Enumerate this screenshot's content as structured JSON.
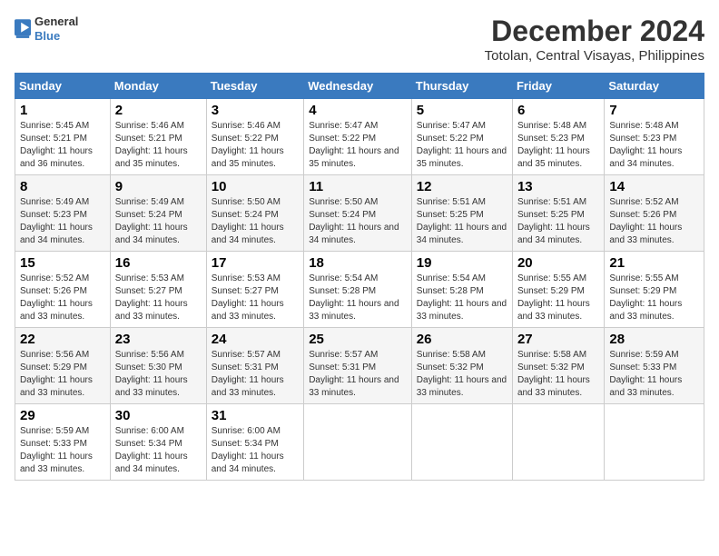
{
  "logo": {
    "line1": "General",
    "line2": "Blue"
  },
  "title": "December 2024",
  "subtitle": "Totolan, Central Visayas, Philippines",
  "headers": [
    "Sunday",
    "Monday",
    "Tuesday",
    "Wednesday",
    "Thursday",
    "Friday",
    "Saturday"
  ],
  "weeks": [
    [
      {
        "day": "1",
        "sunrise": "5:45 AM",
        "sunset": "5:21 PM",
        "daylight": "11 hours and 36 minutes."
      },
      {
        "day": "2",
        "sunrise": "5:46 AM",
        "sunset": "5:21 PM",
        "daylight": "11 hours and 35 minutes."
      },
      {
        "day": "3",
        "sunrise": "5:46 AM",
        "sunset": "5:22 PM",
        "daylight": "11 hours and 35 minutes."
      },
      {
        "day": "4",
        "sunrise": "5:47 AM",
        "sunset": "5:22 PM",
        "daylight": "11 hours and 35 minutes."
      },
      {
        "day": "5",
        "sunrise": "5:47 AM",
        "sunset": "5:22 PM",
        "daylight": "11 hours and 35 minutes."
      },
      {
        "day": "6",
        "sunrise": "5:48 AM",
        "sunset": "5:23 PM",
        "daylight": "11 hours and 35 minutes."
      },
      {
        "day": "7",
        "sunrise": "5:48 AM",
        "sunset": "5:23 PM",
        "daylight": "11 hours and 34 minutes."
      }
    ],
    [
      {
        "day": "8",
        "sunrise": "5:49 AM",
        "sunset": "5:23 PM",
        "daylight": "11 hours and 34 minutes."
      },
      {
        "day": "9",
        "sunrise": "5:49 AM",
        "sunset": "5:24 PM",
        "daylight": "11 hours and 34 minutes."
      },
      {
        "day": "10",
        "sunrise": "5:50 AM",
        "sunset": "5:24 PM",
        "daylight": "11 hours and 34 minutes."
      },
      {
        "day": "11",
        "sunrise": "5:50 AM",
        "sunset": "5:24 PM",
        "daylight": "11 hours and 34 minutes."
      },
      {
        "day": "12",
        "sunrise": "5:51 AM",
        "sunset": "5:25 PM",
        "daylight": "11 hours and 34 minutes."
      },
      {
        "day": "13",
        "sunrise": "5:51 AM",
        "sunset": "5:25 PM",
        "daylight": "11 hours and 34 minutes."
      },
      {
        "day": "14",
        "sunrise": "5:52 AM",
        "sunset": "5:26 PM",
        "daylight": "11 hours and 33 minutes."
      }
    ],
    [
      {
        "day": "15",
        "sunrise": "5:52 AM",
        "sunset": "5:26 PM",
        "daylight": "11 hours and 33 minutes."
      },
      {
        "day": "16",
        "sunrise": "5:53 AM",
        "sunset": "5:27 PM",
        "daylight": "11 hours and 33 minutes."
      },
      {
        "day": "17",
        "sunrise": "5:53 AM",
        "sunset": "5:27 PM",
        "daylight": "11 hours and 33 minutes."
      },
      {
        "day": "18",
        "sunrise": "5:54 AM",
        "sunset": "5:28 PM",
        "daylight": "11 hours and 33 minutes."
      },
      {
        "day": "19",
        "sunrise": "5:54 AM",
        "sunset": "5:28 PM",
        "daylight": "11 hours and 33 minutes."
      },
      {
        "day": "20",
        "sunrise": "5:55 AM",
        "sunset": "5:29 PM",
        "daylight": "11 hours and 33 minutes."
      },
      {
        "day": "21",
        "sunrise": "5:55 AM",
        "sunset": "5:29 PM",
        "daylight": "11 hours and 33 minutes."
      }
    ],
    [
      {
        "day": "22",
        "sunrise": "5:56 AM",
        "sunset": "5:29 PM",
        "daylight": "11 hours and 33 minutes."
      },
      {
        "day": "23",
        "sunrise": "5:56 AM",
        "sunset": "5:30 PM",
        "daylight": "11 hours and 33 minutes."
      },
      {
        "day": "24",
        "sunrise": "5:57 AM",
        "sunset": "5:31 PM",
        "daylight": "11 hours and 33 minutes."
      },
      {
        "day": "25",
        "sunrise": "5:57 AM",
        "sunset": "5:31 PM",
        "daylight": "11 hours and 33 minutes."
      },
      {
        "day": "26",
        "sunrise": "5:58 AM",
        "sunset": "5:32 PM",
        "daylight": "11 hours and 33 minutes."
      },
      {
        "day": "27",
        "sunrise": "5:58 AM",
        "sunset": "5:32 PM",
        "daylight": "11 hours and 33 minutes."
      },
      {
        "day": "28",
        "sunrise": "5:59 AM",
        "sunset": "5:33 PM",
        "daylight": "11 hours and 33 minutes."
      }
    ],
    [
      {
        "day": "29",
        "sunrise": "5:59 AM",
        "sunset": "5:33 PM",
        "daylight": "11 hours and 33 minutes."
      },
      {
        "day": "30",
        "sunrise": "6:00 AM",
        "sunset": "5:34 PM",
        "daylight": "11 hours and 34 minutes."
      },
      {
        "day": "31",
        "sunrise": "6:00 AM",
        "sunset": "5:34 PM",
        "daylight": "11 hours and 34 minutes."
      },
      null,
      null,
      null,
      null
    ]
  ]
}
